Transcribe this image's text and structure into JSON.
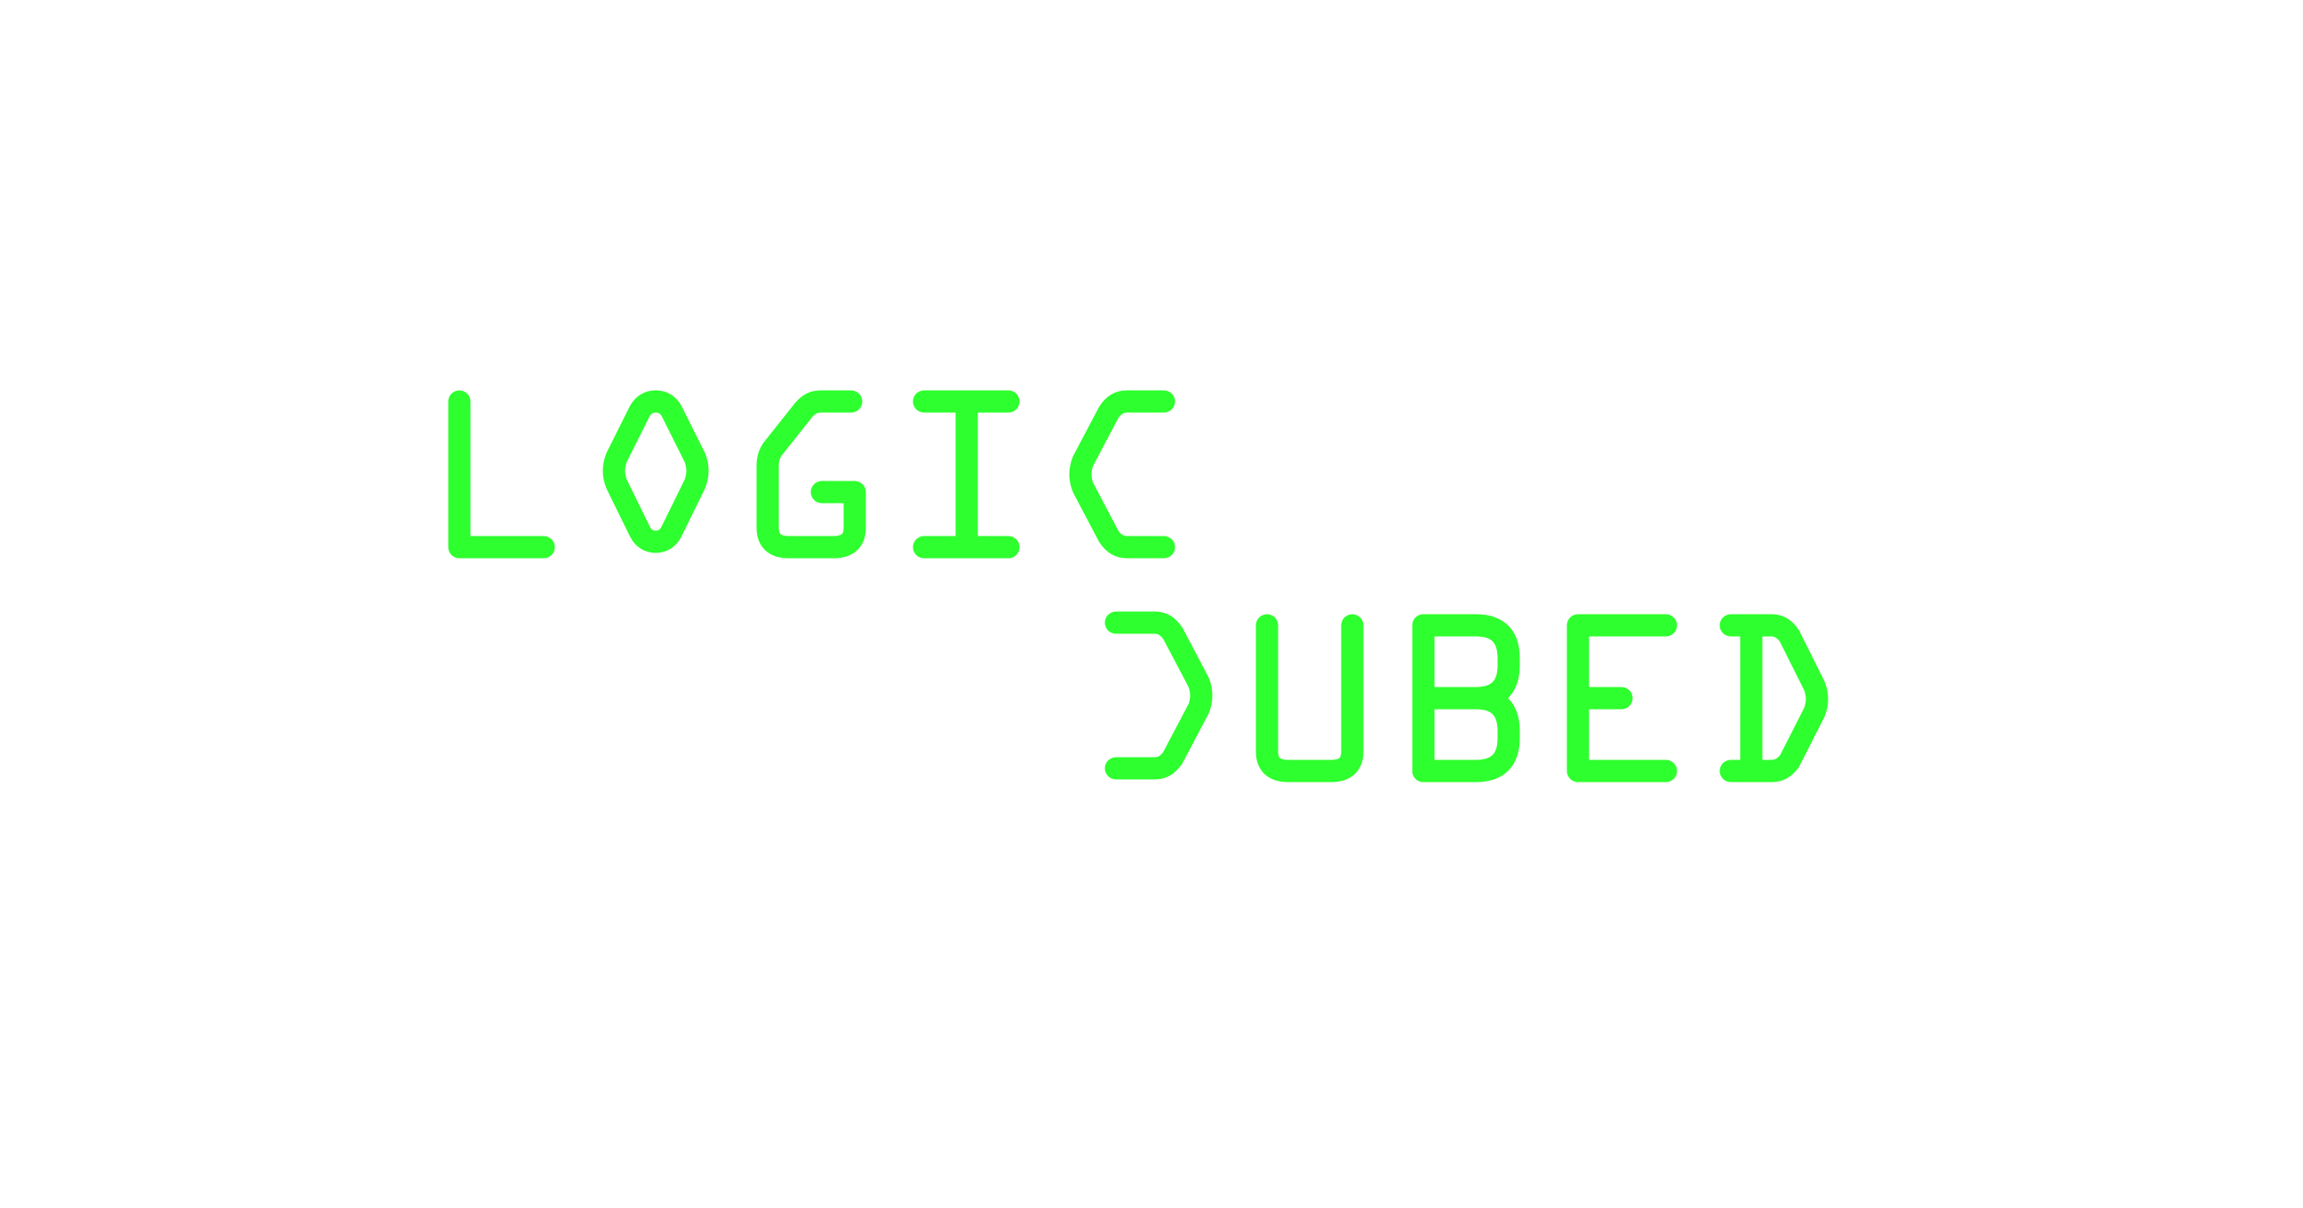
{
  "logo": {
    "line1": "LOGIC",
    "line2": "CUBED",
    "color": "#2EFF2E",
    "background": "#FFFFFF"
  }
}
